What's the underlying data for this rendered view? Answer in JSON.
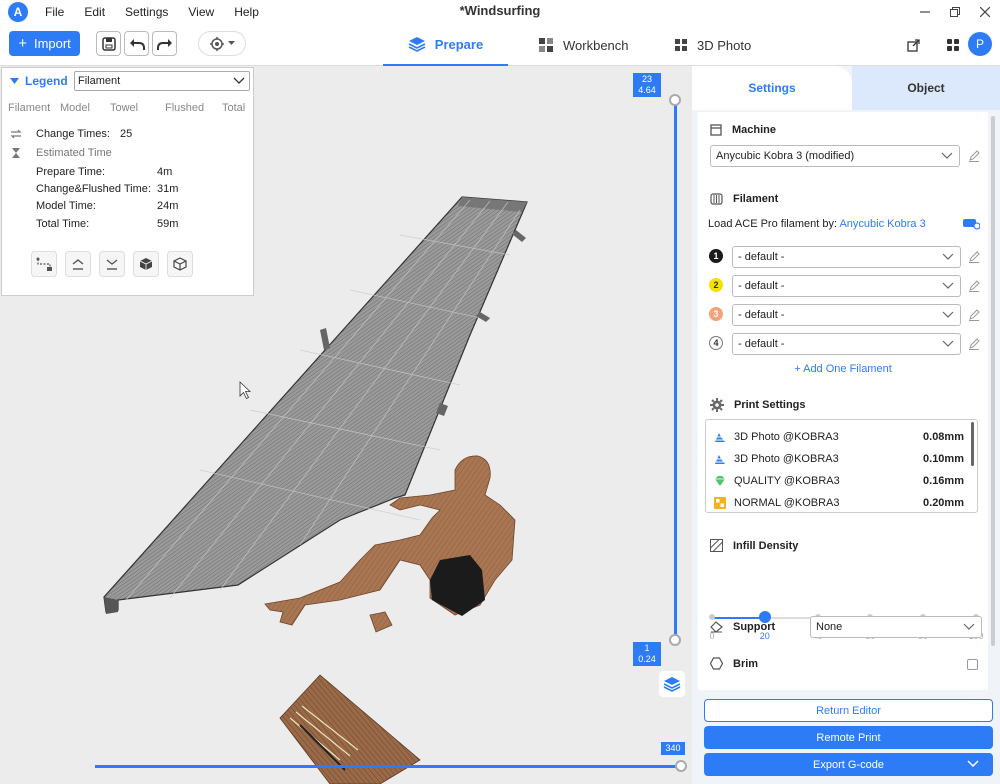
{
  "titlebar": {
    "logo": "A",
    "title": "*Windsurfing",
    "menu": [
      "File",
      "Edit",
      "Settings",
      "View",
      "Help"
    ]
  },
  "toolbar": {
    "import_label": "Import",
    "tabs": [
      {
        "label": "Prepare",
        "active": true
      },
      {
        "label": "Workbench",
        "active": false
      },
      {
        "label": "3D Photo",
        "active": false
      }
    ],
    "avatar_initial": "P"
  },
  "legend": {
    "title": "Legend",
    "mode": "Filament",
    "columns": [
      "Filament",
      "Model",
      "Towel",
      "Flushed",
      "Total"
    ],
    "change_times_label": "Change Times:",
    "change_times_value": "25",
    "estimated_time_label": "Estimated Time",
    "rows": [
      {
        "label": "Prepare Time:",
        "value": "4m"
      },
      {
        "label": "Change&Flushed Time:",
        "value": "31m"
      },
      {
        "label": "Model Time:",
        "value": "24m"
      },
      {
        "label": "Total Time:",
        "value": "59m"
      }
    ]
  },
  "layer_slider": {
    "top_layer": "23",
    "top_height": "4.64",
    "bottom_layer": "1",
    "bottom_height": "0.24",
    "move_value": "340"
  },
  "panel": {
    "tabs": [
      "Settings",
      "Object"
    ],
    "machine": {
      "title": "Machine",
      "value": "Anycubic Kobra 3 (modified)"
    },
    "filament": {
      "title": "Filament",
      "load_label": "Load ACE Pro filament by:",
      "load_link": "Anycubic Kobra 3",
      "slots": [
        {
          "num": "1",
          "value": "- default -",
          "color": "#1a1a1a",
          "text_color": "#ffffff"
        },
        {
          "num": "2",
          "value": "- default -",
          "color": "#f5e100",
          "text_color": "#333333"
        },
        {
          "num": "3",
          "value": "- default -",
          "color": "#f4a27a",
          "text_color": "#ffffff"
        },
        {
          "num": "4",
          "value": "- default -",
          "color": "#ffffff",
          "text_color": "#333333"
        }
      ],
      "add_label": "+ Add One Filament"
    },
    "print_settings": {
      "title": "Print Settings",
      "profiles": [
        {
          "name": "3D Photo @KOBRA3",
          "value": "0.08mm",
          "icon": "photo-profile-icon"
        },
        {
          "name": "3D Photo @KOBRA3",
          "value": "0.10mm",
          "icon": "photo-profile-icon"
        },
        {
          "name": "QUALITY @KOBRA3",
          "value": "0.16mm",
          "icon": "quality-diamond-icon"
        },
        {
          "name": "NORMAL @KOBRA3",
          "value": "0.20mm",
          "icon": "normal-profile-icon"
        }
      ]
    },
    "infill": {
      "title": "Infill Density",
      "value": 20,
      "ticks": [
        "0",
        "20",
        "40",
        "60",
        "80",
        "100"
      ]
    },
    "support": {
      "title": "Support",
      "value": "None"
    },
    "brim": {
      "title": "Brim",
      "checked": false
    },
    "buttons": {
      "return_editor": "Return Editor",
      "remote_print": "Remote Print",
      "export_gcode": "Export G-code"
    }
  },
  "colors": {
    "accent": "#2d7cf6",
    "model_sail": "#8a8a8a",
    "model_figure": "#a87652"
  }
}
